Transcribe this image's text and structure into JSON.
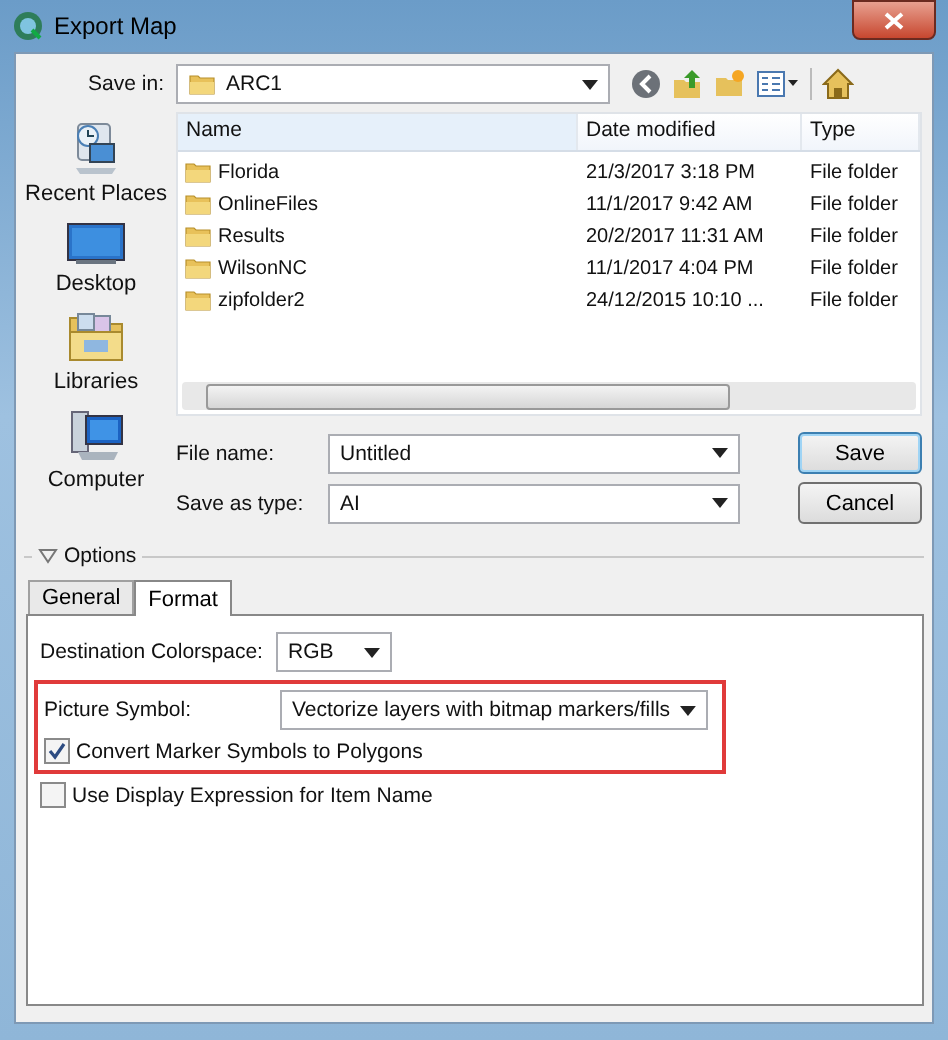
{
  "window": {
    "title": "Export Map"
  },
  "save_in": {
    "label": "Save in:",
    "value": "ARC1"
  },
  "places": [
    {
      "label": "Recent Places",
      "kind": "recent"
    },
    {
      "label": "Desktop",
      "kind": "desktop"
    },
    {
      "label": "Libraries",
      "kind": "libraries"
    },
    {
      "label": "Computer",
      "kind": "computer"
    }
  ],
  "file_list": {
    "columns": [
      "Name",
      "Date modified",
      "Type"
    ],
    "rows": [
      {
        "name": "Florida",
        "date": "21/3/2017 3:18 PM",
        "type": "File folder"
      },
      {
        "name": "OnlineFiles",
        "date": "11/1/2017 9:42 AM",
        "type": "File folder"
      },
      {
        "name": "Results",
        "date": "20/2/2017 11:31 AM",
        "type": "File folder"
      },
      {
        "name": "WilsonNC",
        "date": "11/1/2017 4:04 PM",
        "type": "File folder"
      },
      {
        "name": "zipfolder2",
        "date": "24/12/2015 10:10 ...",
        "type": "File folder"
      }
    ]
  },
  "file_name": {
    "label": "File name:",
    "value": "Untitled"
  },
  "save_as_type": {
    "label": "Save as type:",
    "value": "AI"
  },
  "buttons": [
    {
      "label": "Save",
      "default": true
    },
    {
      "label": "Cancel",
      "default": false
    }
  ],
  "options": {
    "label": "Options",
    "expanded": true
  },
  "tabs": [
    {
      "label": "General",
      "selected": false
    },
    {
      "label": "Format",
      "selected": true
    }
  ],
  "format": {
    "colorspace": {
      "label": "Destination Colorspace:",
      "value": "RGB"
    },
    "highlight": {
      "picture_symbol": {
        "label": "Picture Symbol:",
        "value": "Vectorize layers with bitmap markers/fills"
      },
      "checkbox": {
        "label": "Convert Marker Symbols to Polygons",
        "checked": true
      }
    },
    "checkbox": {
      "label": "Use Display Expression for Item Name",
      "checked": false
    }
  }
}
